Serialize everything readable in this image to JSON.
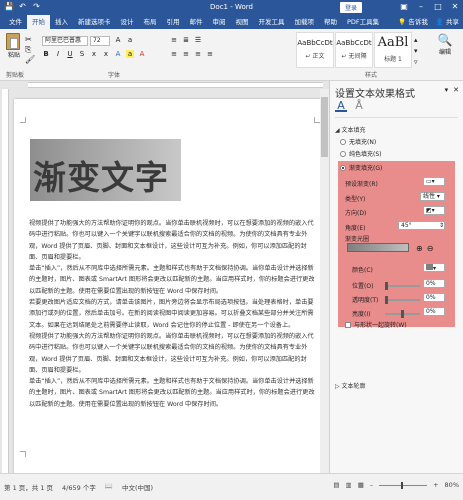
{
  "titlebar": {
    "title": "Doc1 - Word",
    "login": "登录",
    "save_icon": "save-icon",
    "undo_icon": "undo-icon",
    "redo_icon": "redo-icon",
    "brand_color": "#2b579a"
  },
  "tabs": [
    "文件",
    "开始",
    "插入",
    "新建选项卡",
    "设计",
    "布局",
    "引用",
    "邮件",
    "审阅",
    "视图",
    "开发工具",
    "加载项",
    "帮助",
    "PDF工具集"
  ],
  "tabs_right": {
    "tell": "告诉我",
    "share": "共享"
  },
  "ribbon": {
    "paste_label": "粘贴",
    "clipboard_label": "剪贴板",
    "font_name": "阿里巴巴普惠",
    "font_size": "72",
    "font_label": "字体",
    "styles_label": "样式",
    "styles": [
      {
        "sample": "AaBbCcDt",
        "name": "↵ 正文"
      },
      {
        "sample": "AaBbCcDt",
        "name": "↵ 无间隔"
      },
      {
        "sample": "AaBl",
        "name": "标题 1"
      }
    ],
    "edit_label": "编辑"
  },
  "document": {
    "art_text": "渐变文字",
    "paragraphs": [
      "视频提供了功能强大的方法帮助你证明你的观点。当你单击联机视频时，可以在想要添加的视频的嵌入代码中进行粘贴。你也可以键入一个关键字以联机搜索最适合你的文档的视频。为使你的文档具有专业外观，Word 提供了页眉、页脚、封面和文本框设计，这些设计可互为补充。例如，你可以添加匹配的封面、页眉和提要栏。",
      "单击“插入”，然后从不同库中选择所需元素。主题和样式也有助于文档保持协调。当你单击设计并选择新的主题时，图片、图表或 SmartArt 图形将会更改以匹配新的主题。当应用样式时，你的标题会进行更改以匹配新的主题。使用在需要位置出现的新按钮在 Word 中保存时间。",
      "若要更改图片适应文档的方式，请单击该图片，图片旁边将会显示布局选项按钮。当处理表格时，单击要添加行或列的位置，然后单击加号。在新的阅读视图中阅读更加容易。可以折叠文档某些部分并关注所需文本。如果在达到结尾处之前需要停止读取，Word 会记住你的停止位置 - 即使在另一个设备上。",
      "视频提供了功能强大的方法帮助你证明你的观点。当你单击联机视频时，可以在想要添加的视频的嵌入代码中进行粘贴。你也可以键入一个关键字以联机搜索最适合你的文档的视频。为使你的文档具有专业外观，Word 提供了页眉、页脚、封面和文本框设计，这些设计可互为补充。例如，你可以添加匹配的封面、页眉和提要栏。",
      "单击“插入”，然后从不同库中选择所需元素。主题和样式也有助于文档保持协调。当你单击设计并选择新的主题时，图片、图表或 SmartArt 图形将会更改以匹配新的主题。当应用样式时，你的标题会进行更改以匹配新的主题。使用在需要位置出现的新按钮在 Word 中保存时间。"
    ]
  },
  "pane": {
    "title": "设置文本效果格式",
    "section_fill": "文本填充",
    "fill_none": "无填充(N)",
    "fill_solid": "纯色填充(S)",
    "fill_gradient": "渐变填充(G)",
    "preset_label": "预设渐变(R)",
    "type_label": "类型(Y)",
    "type_value": "线性",
    "direction_label": "方向(D)",
    "angle_label": "角度(E)",
    "angle_value": "45°",
    "stops_label": "渐变光圈",
    "color_label": "颜色(C)",
    "position_label": "位置(O)",
    "position_value": "0%",
    "transparency_label": "透明度(T)",
    "transparency_value": "0%",
    "brightness_label": "亮度(I)",
    "brightness_value": "0%",
    "rotate_label": "与形状一起旋转(W)",
    "section_outline": "文本轮廓",
    "highlight_color": "#e06b6b"
  },
  "status": {
    "page": "第 1 页，共 1 页",
    "words": "4/659 个字",
    "lang": "中文(中国)",
    "zoom": "80%"
  }
}
